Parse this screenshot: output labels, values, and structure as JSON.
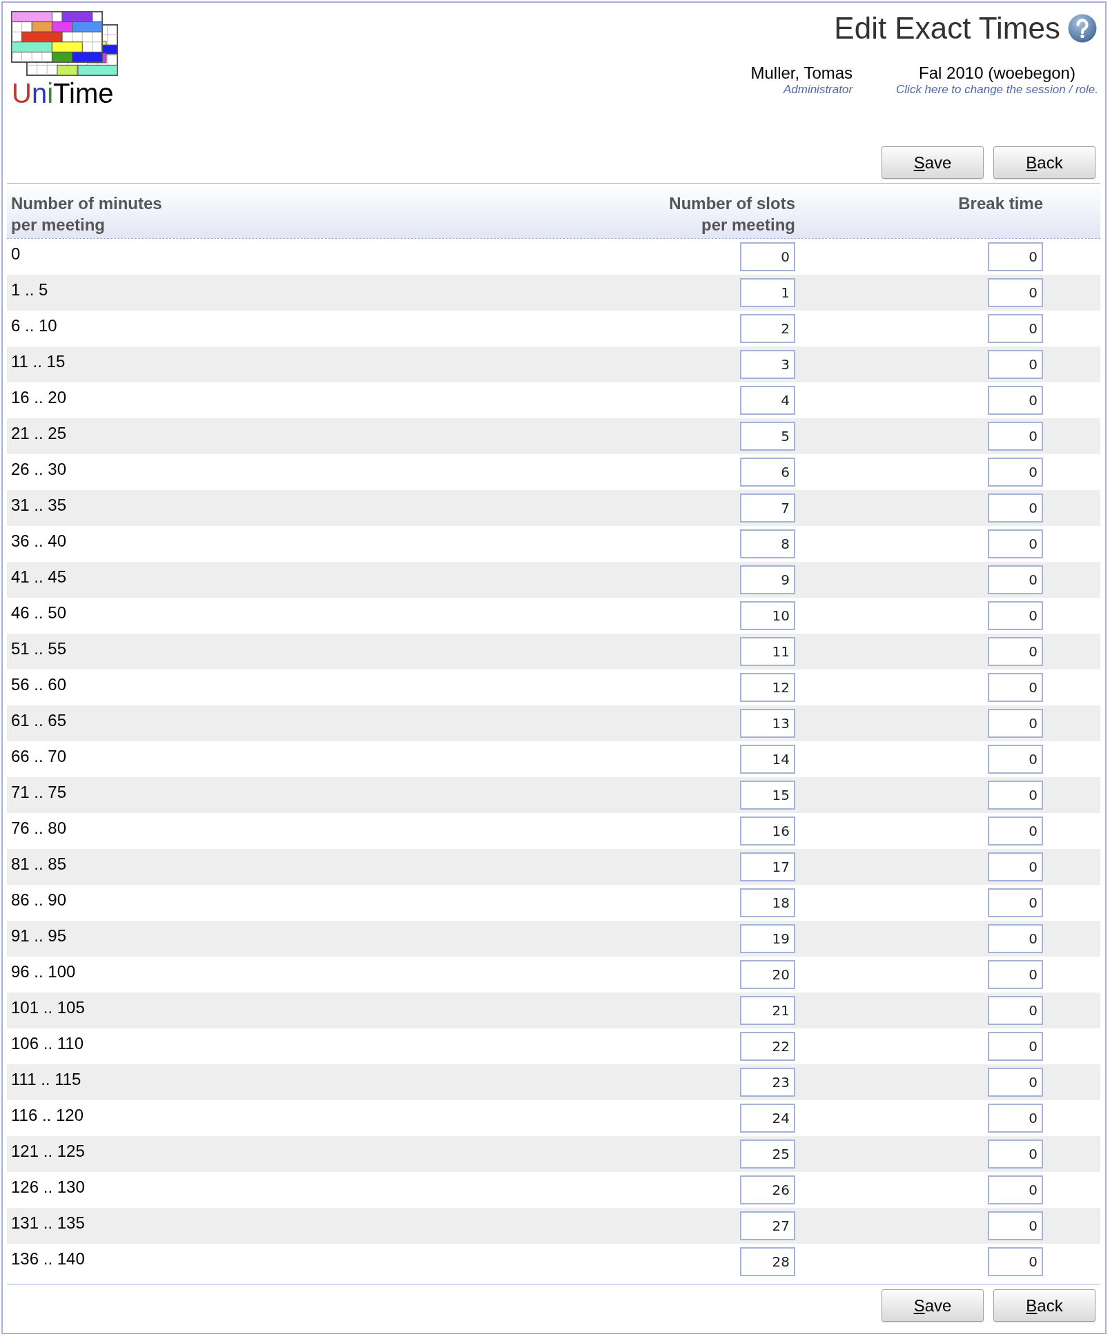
{
  "header": {
    "logo_text": "UniTime",
    "title": "Edit Exact Times",
    "user": {
      "name": "Muller, Tomas",
      "role": "Administrator"
    },
    "session": {
      "name": "Fal 2010 (woebegon)",
      "link": "Click here to change the session / role."
    }
  },
  "top_buttons": [
    "Save",
    "Back"
  ],
  "table": {
    "columns": [
      "Number of minutes per meeting",
      "Number of slots per meeting",
      "Break time"
    ],
    "rows": [
      {
        "minutes": "0",
        "slots": "0",
        "break_time": "0"
      },
      {
        "minutes": "1 .. 5",
        "slots": "1",
        "break_time": "0"
      },
      {
        "minutes": "6 .. 10",
        "slots": "2",
        "break_time": "0"
      },
      {
        "minutes": "11 .. 15",
        "slots": "3",
        "break_time": "0"
      },
      {
        "minutes": "16 .. 20",
        "slots": "4",
        "break_time": "0"
      },
      {
        "minutes": "21 .. 25",
        "slots": "5",
        "break_time": "0"
      },
      {
        "minutes": "26 .. 30",
        "slots": "6",
        "break_time": "0"
      },
      {
        "minutes": "31 .. 35",
        "slots": "7",
        "break_time": "0"
      },
      {
        "minutes": "36 .. 40",
        "slots": "8",
        "break_time": "0"
      },
      {
        "minutes": "41 .. 45",
        "slots": "9",
        "break_time": "0"
      },
      {
        "minutes": "46 .. 50",
        "slots": "10",
        "break_time": "0"
      },
      {
        "minutes": "51 .. 55",
        "slots": "11",
        "break_time": "0"
      },
      {
        "minutes": "56 .. 60",
        "slots": "12",
        "break_time": "0"
      },
      {
        "minutes": "61 .. 65",
        "slots": "13",
        "break_time": "0"
      },
      {
        "minutes": "66 .. 70",
        "slots": "14",
        "break_time": "0"
      },
      {
        "minutes": "71 .. 75",
        "slots": "15",
        "break_time": "0"
      },
      {
        "minutes": "76 .. 80",
        "slots": "16",
        "break_time": "0"
      },
      {
        "minutes": "81 .. 85",
        "slots": "17",
        "break_time": "0"
      },
      {
        "minutes": "86 .. 90",
        "slots": "18",
        "break_time": "0"
      },
      {
        "minutes": "91 .. 95",
        "slots": "19",
        "break_time": "0"
      },
      {
        "minutes": "96 .. 100",
        "slots": "20",
        "break_time": "0"
      },
      {
        "minutes": "101 .. 105",
        "slots": "21",
        "break_time": "0"
      },
      {
        "minutes": "106 .. 110",
        "slots": "22",
        "break_time": "0"
      },
      {
        "minutes": "111 .. 115",
        "slots": "23",
        "break_time": "0"
      },
      {
        "minutes": "116 .. 120",
        "slots": "24",
        "break_time": "0"
      },
      {
        "minutes": "121 .. 125",
        "slots": "25",
        "break_time": "0"
      },
      {
        "minutes": "126 .. 130",
        "slots": "26",
        "break_time": "0"
      },
      {
        "minutes": "131 .. 135",
        "slots": "27",
        "break_time": "0"
      },
      {
        "minutes": "136 .. 140",
        "slots": "28",
        "break_time": "0"
      }
    ]
  },
  "bottom_buttons": [
    "Save",
    "Back"
  ]
}
